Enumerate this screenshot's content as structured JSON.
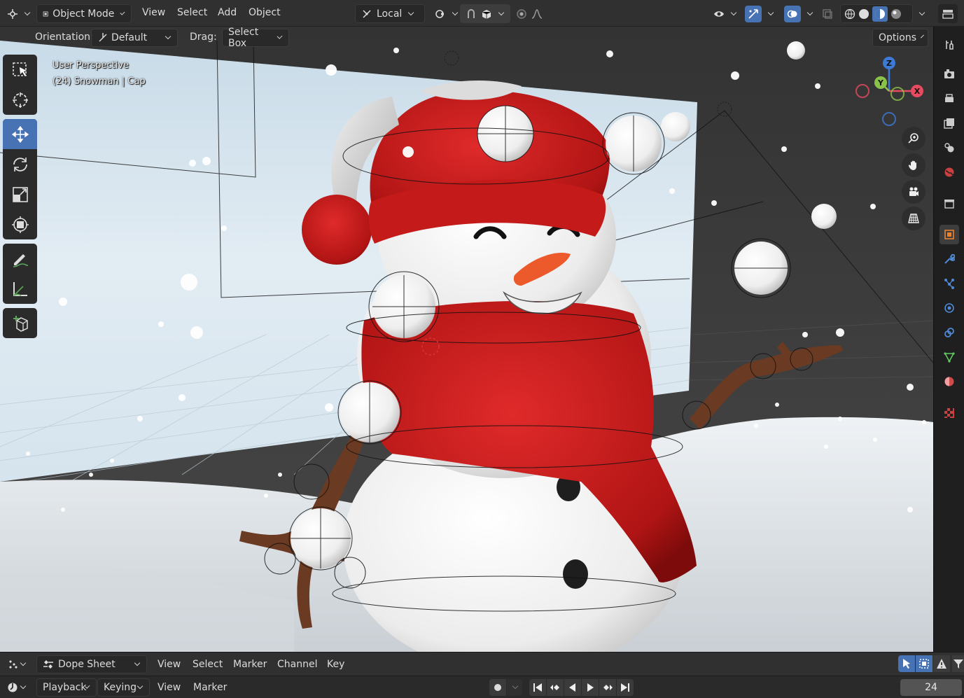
{
  "header": {
    "editor_type_icon": "3d-viewport-icon",
    "mode": {
      "icon": "object-mode-icon",
      "label": "Object Mode"
    },
    "menus": [
      "View",
      "Select",
      "Add",
      "Object"
    ],
    "transform_orientation": {
      "icon": "local-orientation-icon",
      "label": "Local"
    },
    "icons_right": [
      "pivot-icon",
      "snap-icon",
      "snap-increment-icon",
      "proportional-edit-icon",
      "falloff-icon",
      "visibility-icon",
      "gizmo-icon",
      "overlay-icon",
      "xray-icon",
      "wireframe-shading-icon",
      "solid-shading-icon",
      "material-shading-icon",
      "rendered-shading-icon",
      "workspace-icon"
    ]
  },
  "viewport_header": {
    "orientation_label": "Orientation:",
    "orientation_value": "Default",
    "drag_label": "Drag:",
    "drag_value": "Select Box",
    "options_label": "Options"
  },
  "viewport": {
    "perspective_text": "User Perspective",
    "object_text": "(24) Snowman | Cap"
  },
  "toolbar": {
    "tools": [
      {
        "name": "select-box-tool",
        "icon": "select-box-icon",
        "active": false
      },
      {
        "name": "cursor-tool",
        "icon": "cursor-icon",
        "active": false
      },
      {
        "name": "move-tool",
        "icon": "move-icon",
        "active": true
      },
      {
        "name": "rotate-tool",
        "icon": "rotate-icon",
        "active": false
      },
      {
        "name": "scale-tool",
        "icon": "scale-icon",
        "active": false
      },
      {
        "name": "transform-tool",
        "icon": "transform-icon",
        "active": false
      },
      {
        "name": "annotate-tool",
        "icon": "annotate-icon",
        "active": false
      },
      {
        "name": "measure-tool",
        "icon": "measure-icon",
        "active": false
      },
      {
        "name": "add-cube-tool",
        "icon": "add-cube-icon",
        "active": false
      }
    ]
  },
  "gizmo": {
    "z_label": "Z",
    "y_label": "Y",
    "x_label": "X",
    "colors": {
      "x": "#e84a5f",
      "y": "#8bc34a",
      "z": "#3d7ad6"
    }
  },
  "properties_tabs": [
    "tool-icon",
    "render-icon",
    "output-icon",
    "view-layer-icon",
    "scene-icon",
    "world-icon",
    "collection-icon",
    "object-icon",
    "modifier-icon",
    "particles-icon",
    "physics-icon",
    "constraints-icon",
    "data-icon",
    "material-icon",
    "texture-icon"
  ],
  "dopesheet": {
    "editor_icon": "dopesheet-editor-icon",
    "mode_icon": "dopesheet-mode-icon",
    "mode_label": "Dope Sheet",
    "menus": [
      "View",
      "Select",
      "Marker",
      "Channel",
      "Key"
    ]
  },
  "timeline": {
    "editor_icon": "timeline-editor-icon",
    "playback_label": "Playback",
    "keying_label": "Keying",
    "menus": [
      "View",
      "Marker"
    ],
    "current_frame": "24"
  },
  "accent_color": "#4772b3"
}
